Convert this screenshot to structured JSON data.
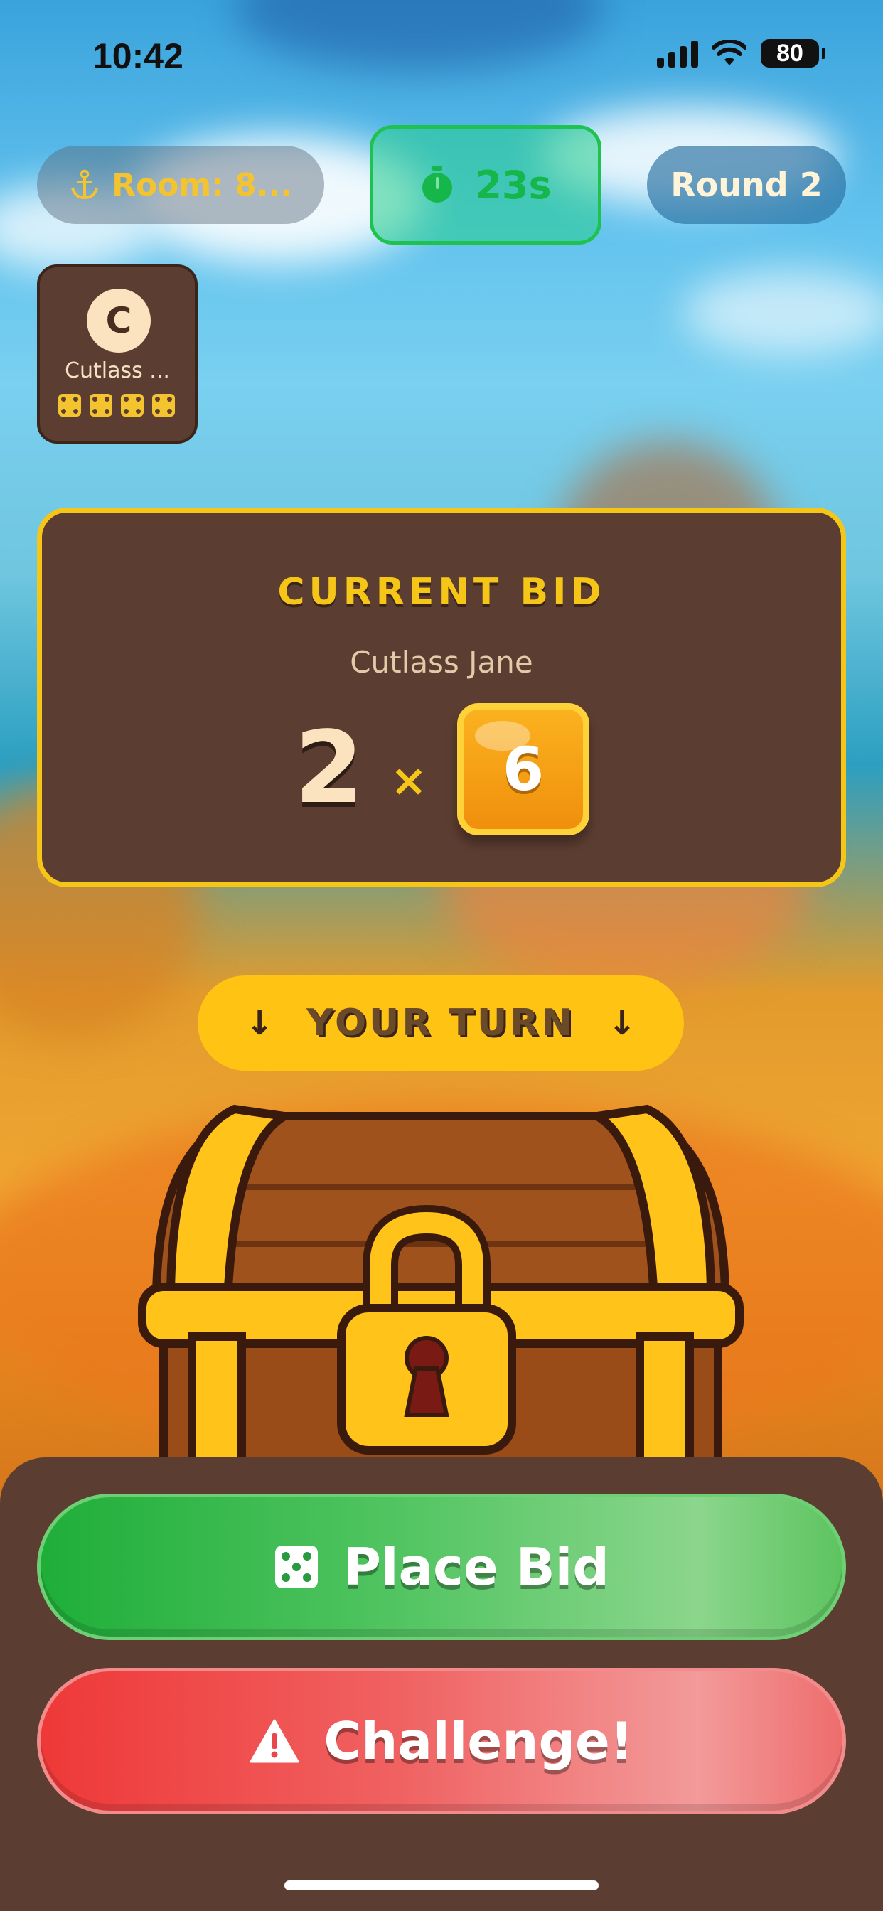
{
  "status_bar": {
    "time": "10:42",
    "battery": "80"
  },
  "header": {
    "room_label": "Room: 8...",
    "timer": "23s",
    "round_label": "Round 2",
    "icons": {
      "room": "anchor-icon",
      "timer": "stopwatch-icon"
    }
  },
  "players": [
    {
      "name": "Cutlass ...",
      "avatar_letter": "C",
      "dice_count": 4
    }
  ],
  "current_bid": {
    "title": "CURRENT BID",
    "bidder": "Cutlass Jane",
    "quantity": "2",
    "multiplier": "×",
    "face": "6"
  },
  "turn_banner": {
    "label": "YOUR TURN"
  },
  "actions": {
    "place_bid": "Place Bid",
    "challenge": "Challenge!"
  },
  "colors": {
    "accent_gold": "#f5c518",
    "panel_brown": "#5c3d31",
    "bid_green": "#1fae39",
    "challenge_red": "#ef3838",
    "timer_green": "#16b74a"
  }
}
